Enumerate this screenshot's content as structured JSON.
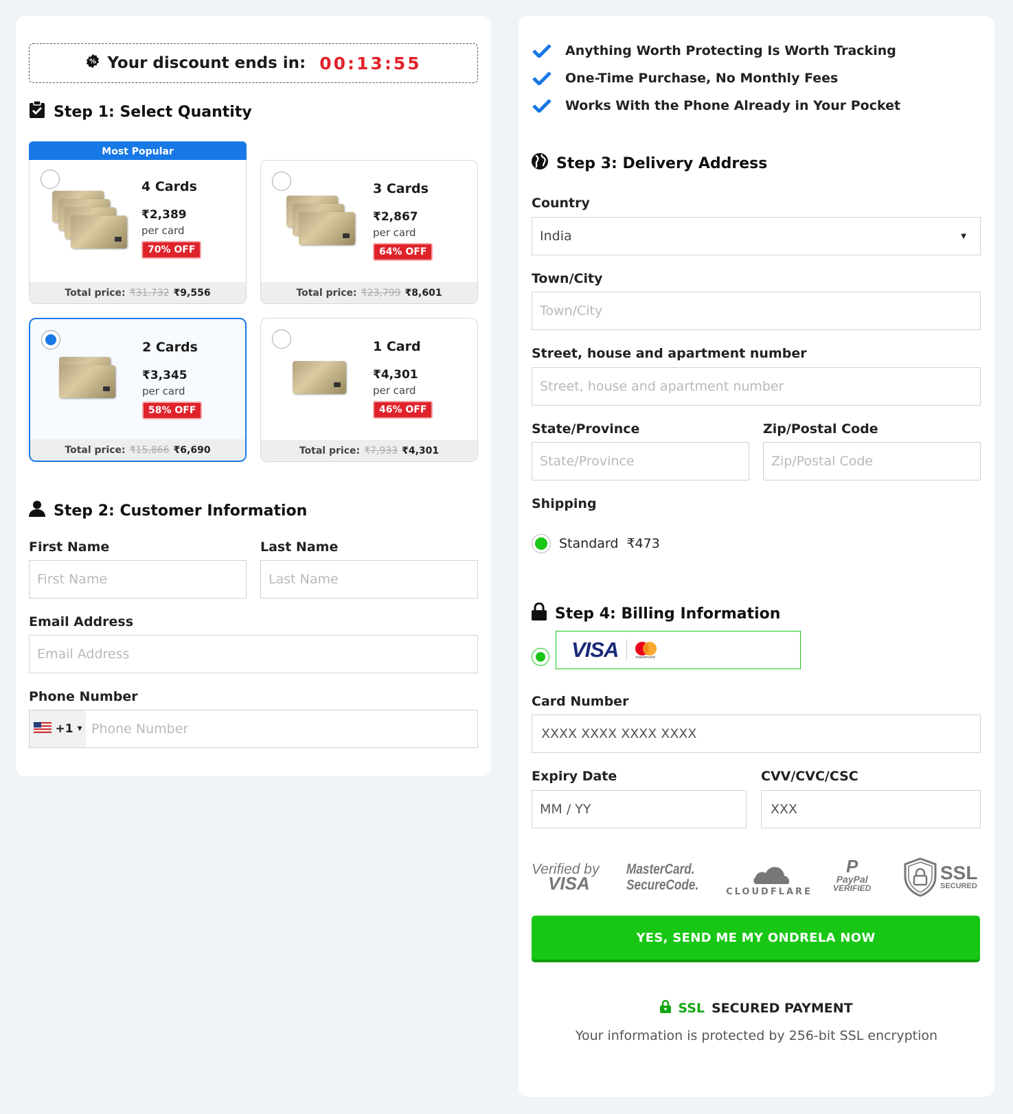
{
  "timer": {
    "label": "Your discount ends in:",
    "value": "00:13:55"
  },
  "step1": {
    "title": "Step 1: Select Quantity",
    "popular_label": "Most Popular"
  },
  "cards": [
    {
      "qty": "4 Cards",
      "price": "₹2,389",
      "per": "per card",
      "off": "70% OFF",
      "total_label": "Total price:",
      "old": "₹31,732",
      "new": "₹9,556",
      "selected": false
    },
    {
      "qty": "3 Cards",
      "price": "₹2,867",
      "per": "per card",
      "off": "64% OFF",
      "total_label": "Total price:",
      "old": "₹23,799",
      "new": "₹8,601",
      "selected": false
    },
    {
      "qty": "2 Cards",
      "price": "₹3,345",
      "per": "per card",
      "off": "58% OFF",
      "total_label": "Total price:",
      "old": "₹15,866",
      "new": "₹6,690",
      "selected": true
    },
    {
      "qty": "1 Card",
      "price": "₹4,301",
      "per": "per card",
      "off": "46% OFF",
      "total_label": "Total price:",
      "old": "₹7,933",
      "new": "₹4,301",
      "selected": false
    }
  ],
  "step2": {
    "title": "Step 2: Customer Information",
    "first_label": "First Name",
    "first_placeholder": "First Name",
    "last_label": "Last Name",
    "last_placeholder": "Last Name",
    "email_label": "Email Address",
    "email_placeholder": "Email Address",
    "phone_label": "Phone Number",
    "phone_code": "+1",
    "phone_placeholder": "Phone Number"
  },
  "features": [
    "Anything Worth Protecting Is Worth Tracking",
    "One-Time Purchase, No Monthly Fees",
    "Works With the Phone Already in Your Pocket"
  ],
  "step3": {
    "title": "Step 3: Delivery Address",
    "country_label": "Country",
    "country_value": "India",
    "city_label": "Town/City",
    "city_placeholder": "Town/City",
    "street_label": "Street, house and apartment number",
    "street_placeholder": "Street, house and apartment number",
    "state_label": "State/Province",
    "state_placeholder": "State/Province",
    "zip_label": "Zip/Postal Code",
    "zip_placeholder": "Zip/Postal Code",
    "shipping_label": "Shipping",
    "shipping_option": "Standard",
    "shipping_price": "₹473"
  },
  "step4": {
    "title": "Step 4: Billing Information",
    "visa_text": "VISA",
    "mastercard_text": "mastercard",
    "card_label": "Card Number",
    "card_placeholder": "XXXX XXXX XXXX XXXX",
    "expiry_label": "Expiry Date",
    "expiry_placeholder": "MM / YY",
    "cvv_label": "CVV/CVC/CSC",
    "cvv_placeholder": "XXX"
  },
  "badges": {
    "verified_top": "Verified by",
    "verified_bottom": "VISA",
    "mc_top": "MasterCard.",
    "mc_bottom": "SecureCode.",
    "cloudflare": "CLOUDFLARE",
    "paypal_top": "PayPal",
    "paypal_bottom": "VERIFIED",
    "ssl": "SSL",
    "ssl_sub": "SECURED"
  },
  "cta": "YES, SEND ME MY ONDRELA NOW",
  "secure": {
    "ssl": "SSL",
    "rest": "SECURED PAYMENT",
    "note": "Your information is protected by 256-bit SSL encryption"
  },
  "colors": {
    "accent_blue": "#1878e6",
    "accent_green": "#18c716",
    "alert_red": "#e0232b"
  }
}
